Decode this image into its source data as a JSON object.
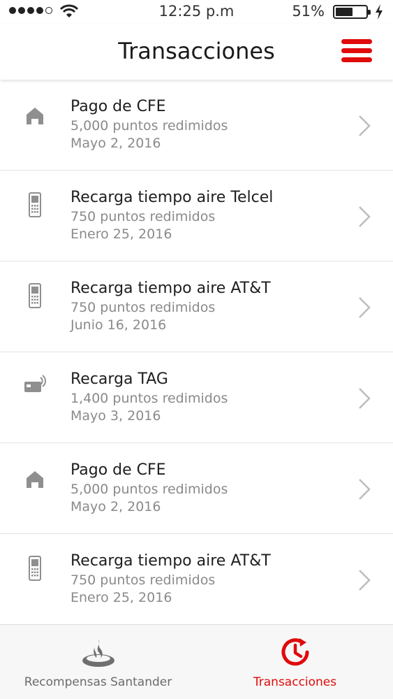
{
  "status_bar": {
    "time": "12:25 p.m",
    "battery_percent": "51%"
  },
  "header": {
    "title": "Transacciones"
  },
  "colors": {
    "accent": "#e00b0b",
    "icon_gray": "#8f8f8f"
  },
  "transactions": [
    {
      "icon": "house-icon",
      "title": "Pago de CFE",
      "points": "5,000 puntos redimidos",
      "date": "Mayo 2, 2016"
    },
    {
      "icon": "phone-icon",
      "title": "Recarga tiempo aire Telcel",
      "points": "750 puntos redimidos",
      "date": "Enero 25, 2016"
    },
    {
      "icon": "phone-icon",
      "title": "Recarga tiempo aire AT&T",
      "points": "750 puntos redimidos",
      "date": "Junio 16, 2016"
    },
    {
      "icon": "tag-card-icon",
      "title": "Recarga TAG",
      "points": "1,400 puntos redimidos",
      "date": "Mayo 3, 2016"
    },
    {
      "icon": "house-icon",
      "title": "Pago de CFE",
      "points": "5,000 puntos redimidos",
      "date": "Mayo 2, 2016"
    },
    {
      "icon": "phone-icon",
      "title": "Recarga tiempo aire AT&T",
      "points": "750 puntos redimidos",
      "date": "Enero 25, 2016"
    }
  ],
  "tabbar": {
    "tabs": [
      {
        "label": "Recompensas Santander",
        "icon": "santander-flame-icon",
        "active": false
      },
      {
        "label": "Transacciones",
        "icon": "clock-history-icon",
        "active": true
      }
    ]
  }
}
